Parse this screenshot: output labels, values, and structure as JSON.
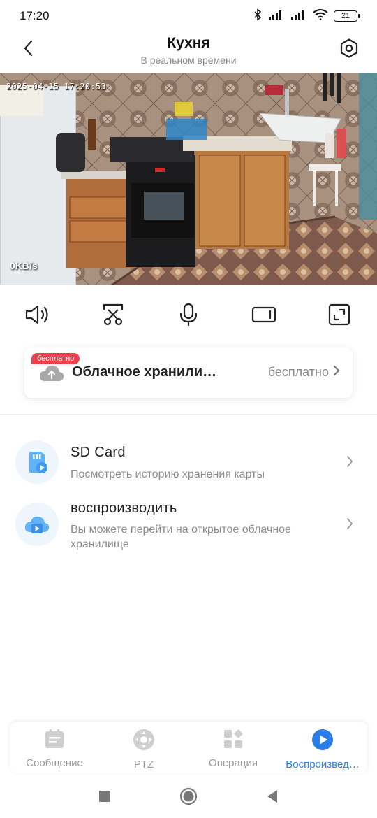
{
  "status_bar": {
    "time": "17:20",
    "battery_level": "21",
    "icons": [
      "bluetooth-icon",
      "signal-icon",
      "signal-icon",
      "wifi-icon",
      "battery-icon"
    ]
  },
  "header": {
    "title": "Кухня",
    "subtitle": "В реальном времени",
    "back_icon": "chevron-left-icon",
    "settings_icon": "hexagon-settings-icon"
  },
  "video": {
    "timestamp": "2025-04-15 17:20:53",
    "bitrate": "0KB/s"
  },
  "controls": [
    {
      "name": "speaker-icon"
    },
    {
      "name": "screenshot-scissors-icon"
    },
    {
      "name": "microphone-icon"
    },
    {
      "name": "video-record-icon"
    },
    {
      "name": "fullscreen-icon"
    }
  ],
  "cloud_card": {
    "badge": "бесплатно",
    "title": "Облачное хранили…",
    "status": "бесплатно",
    "icon": "cloud-upload-icon"
  },
  "list": [
    {
      "title": "SD Card",
      "description": "Посмотреть историю хранения карты",
      "icon": "sd-card-play-icon"
    },
    {
      "title": "воспроизводить",
      "description": "Вы можете перейти на открытое облачное хранилище",
      "icon": "cloud-play-icon"
    }
  ],
  "tabs": [
    {
      "label": "Сообщение",
      "icon": "message-icon",
      "active": false
    },
    {
      "label": "PTZ",
      "icon": "ptz-icon",
      "active": false
    },
    {
      "label": "Операция",
      "icon": "operation-icon",
      "active": false
    },
    {
      "label": "Воспроизвед…",
      "icon": "playback-icon",
      "active": true
    }
  ],
  "colors": {
    "accent": "#2b7de9",
    "badge": "#ee3f4d",
    "muted_text": "#8c8c8c"
  }
}
